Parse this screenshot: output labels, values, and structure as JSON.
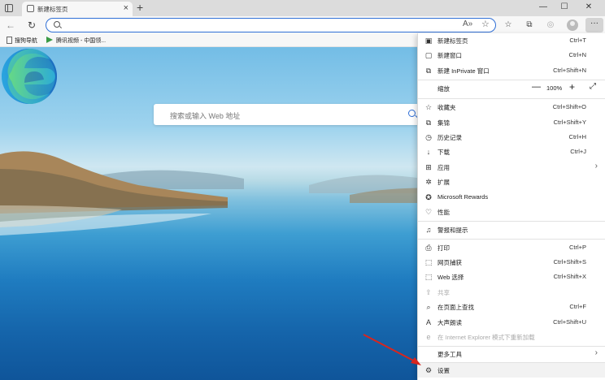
{
  "tab": {
    "title": "新建标签页",
    "close": "×"
  },
  "newtab": "+",
  "window": {
    "minimize": "—",
    "maximize": "☐",
    "close": "✕"
  },
  "nav": {
    "back": "←",
    "reload": "↻"
  },
  "toolbar": {
    "read_aloud": "A»",
    "favorite": "☆",
    "favorites": "☆",
    "collections": "⧉",
    "performance": "◎",
    "more": "···"
  },
  "favorites_bar": [
    {
      "label": "搜狗导航"
    },
    {
      "label": "腾讯视频 - 中国领..."
    }
  ],
  "search": {
    "placeholder": "搜索或输入 Web 地址"
  },
  "menu": {
    "items": [
      {
        "icon": "▣",
        "label": "新建标签页",
        "shortcut": "Ctrl+T"
      },
      {
        "icon": "▢",
        "label": "新建窗口",
        "shortcut": "Ctrl+N"
      },
      {
        "icon": "⧉",
        "label": "新建 InPrivate 窗口",
        "shortcut": "Ctrl+Shift+N"
      },
      {
        "label": "缩放",
        "zoom": {
          "minus": "—",
          "value": "100%",
          "plus": "+",
          "full": "⤢"
        }
      },
      {
        "icon": "☆",
        "label": "收藏夹",
        "shortcut": "Ctrl+Shift+O"
      },
      {
        "icon": "⧉",
        "label": "集锦",
        "shortcut": "Ctrl+Shift+Y"
      },
      {
        "icon": "◷",
        "label": "历史记录",
        "shortcut": "Ctrl+H"
      },
      {
        "icon": "↓",
        "label": "下载",
        "shortcut": "Ctrl+J"
      },
      {
        "icon": "⊞",
        "label": "应用",
        "arrow": "›"
      },
      {
        "icon": "✲",
        "label": "扩展"
      },
      {
        "icon": "✪",
        "label": "Microsoft Rewards"
      },
      {
        "icon": "♡",
        "label": "性能"
      },
      {
        "icon": "♫",
        "label": "警报和提示"
      },
      {
        "icon": "⎙",
        "label": "打印",
        "shortcut": "Ctrl+P"
      },
      {
        "icon": "⬚",
        "label": "网页捕获",
        "shortcut": "Ctrl+Shift+S"
      },
      {
        "icon": "⬚",
        "label": "Web 选择",
        "shortcut": "Ctrl+Shift+X"
      },
      {
        "icon": "⇪",
        "label": "共享",
        "disabled": true
      },
      {
        "icon": "⌕",
        "label": "在页面上查找",
        "shortcut": "Ctrl+F"
      },
      {
        "icon": "A",
        "label": "大声朗读",
        "shortcut": "Ctrl+Shift+U"
      },
      {
        "icon": "e",
        "label": "在 Internet Explorer 模式下重新加载",
        "disabled": true
      },
      {
        "label": "更多工具",
        "arrow": "›"
      },
      {
        "icon": "⚙",
        "label": "设置"
      }
    ]
  }
}
